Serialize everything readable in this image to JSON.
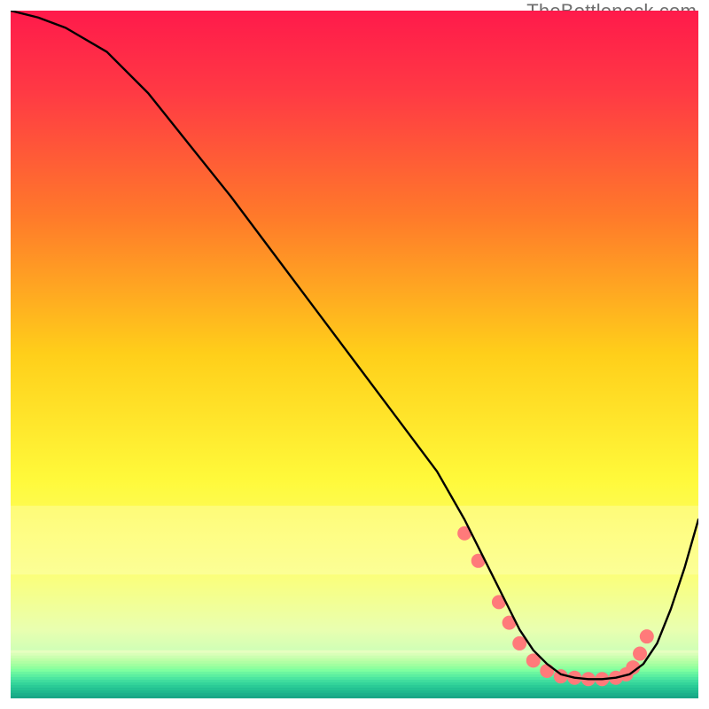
{
  "watermark": "TheBottleneck.com",
  "chart_data": {
    "type": "line",
    "title": "",
    "xlabel": "",
    "ylabel": "",
    "xlim": [
      0,
      100
    ],
    "ylim": [
      0,
      100
    ],
    "background": {
      "type": "vertical-gradient",
      "stops": [
        {
          "pos": 0.0,
          "color": "#ff1a4b"
        },
        {
          "pos": 0.12,
          "color": "#ff3a44"
        },
        {
          "pos": 0.3,
          "color": "#ff7a2a"
        },
        {
          "pos": 0.5,
          "color": "#ffcf1a"
        },
        {
          "pos": 0.68,
          "color": "#fff93a"
        },
        {
          "pos": 0.82,
          "color": "#fbff7a"
        },
        {
          "pos": 0.9,
          "color": "#e9ffb0"
        },
        {
          "pos": 0.94,
          "color": "#c8ffb8"
        },
        {
          "pos": 0.965,
          "color": "#7affa0"
        },
        {
          "pos": 0.985,
          "color": "#28e89c"
        },
        {
          "pos": 1.0,
          "color": "#1fd28f"
        }
      ]
    },
    "series": [
      {
        "name": "curve",
        "color": "#000000",
        "x": [
          0,
          4,
          8,
          14,
          20,
          26,
          32,
          38,
          44,
          50,
          56,
          62,
          66,
          68,
          70,
          72,
          74,
          76,
          78,
          80,
          82,
          84,
          86,
          88,
          90,
          92,
          94,
          96,
          98,
          100
        ],
        "y": [
          100,
          99,
          97.5,
          94,
          88,
          80.5,
          73,
          65,
          57,
          49,
          41,
          33,
          26,
          22,
          18,
          14,
          10,
          7,
          5,
          3.5,
          3,
          2.8,
          2.8,
          3,
          3.5,
          5,
          8,
          13,
          19,
          26
        ]
      }
    ],
    "markers": {
      "name": "dots",
      "color": "#ff7a7a",
      "radius_px": 8,
      "x": [
        66,
        68,
        71,
        72.5,
        74,
        76,
        78,
        80,
        82,
        84,
        86,
        88,
        89.5,
        90.5,
        91.5,
        92.5
      ],
      "y": [
        24,
        20,
        14,
        11,
        8,
        5.5,
        4,
        3.2,
        3,
        2.8,
        2.8,
        3,
        3.5,
        4.5,
        6.5,
        9
      ]
    }
  }
}
